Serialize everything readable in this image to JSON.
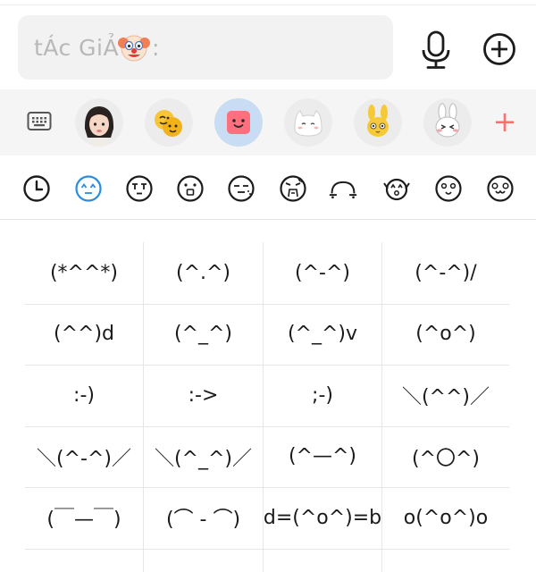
{
  "input": {
    "text": "tÁc GiẢ",
    "suffix": ":"
  },
  "toolbar": {
    "mic_icon": "microphone-icon",
    "add_icon": "plus-circle-icon"
  },
  "stickers": {
    "items": [
      "keyboard-icon",
      "girl-avatar-sticker",
      "emoji-pair-sticker",
      "pink-face-sticker",
      "white-cat-sticker",
      "yellow-bunny-sticker",
      "white-rabbit-sticker"
    ],
    "add_label": "+",
    "active_color": "#c8dcf4",
    "add_color": "#ff6f6f"
  },
  "categories": [
    "clock-icon",
    "happy-face-icon",
    "crying-face-icon",
    "surprised-face-icon",
    "sleepy-face-icon",
    "angry-face-icon",
    "peeking-face-icon",
    "cheering-face-icon",
    "shocked-face-icon",
    "bear-face-icon"
  ],
  "kaomoji": {
    "rows": [
      [
        "(*^^*)",
        "(^.^)",
        "(^-^)",
        "(^-^)/"
      ],
      [
        "(^^)d",
        "(^_^)",
        "(^_^)v",
        "(^o^)"
      ],
      [
        ":-)",
        ":->",
        ";-)",
        "＼(^^)／"
      ],
      [
        "＼(^-^)／",
        "＼(^_^)／",
        "(^—^)",
        "(^〇^)"
      ],
      [
        "(￣—￣)",
        "(⌒ - ⌒)",
        "d=(^o^)=b",
        "o(^o^)o"
      ]
    ]
  }
}
